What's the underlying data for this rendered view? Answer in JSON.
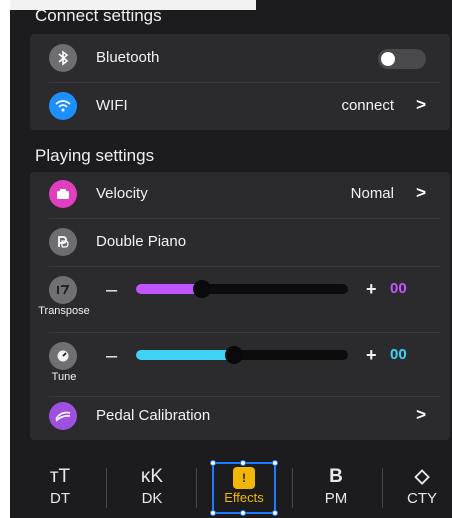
{
  "connect": {
    "title": "Connect settings",
    "bluetooth": {
      "label": "Bluetooth",
      "icon": "bluetooth-icon",
      "enabled": false
    },
    "wifi": {
      "label": "WIFI",
      "icon": "wifi-icon",
      "value": "connect",
      "chevron": ">"
    }
  },
  "playing": {
    "title": "Playing settings",
    "velocity": {
      "label": "Velocity",
      "icon": "velocity-icon",
      "value": "Nomal",
      "chevron": ">"
    },
    "double_piano": {
      "label": "Double Piano",
      "icon": "double-piano-icon"
    },
    "transpose": {
      "caption": "Transpose",
      "minus": "–",
      "plus": "+",
      "value_text": "00",
      "level": 0.31,
      "color": "#c056ff"
    },
    "tune": {
      "caption": "Tune",
      "minus": "–",
      "plus": "+",
      "value_text": "00",
      "level": 0.46,
      "color": "#3fd2f5"
    },
    "pedal": {
      "label": "Pedal Calibration",
      "icon": "pedal-icon",
      "chevron": ">"
    }
  },
  "tabs": [
    {
      "glyph": "ᴛT",
      "label": "DT",
      "active": false
    },
    {
      "glyph": "ᴋK",
      "label": "DK",
      "active": false
    },
    {
      "glyph": "!",
      "label": "Effects",
      "active": true
    },
    {
      "glyph": "B",
      "label": "PM",
      "active": false
    },
    {
      "glyph": "◇",
      "label": "CTY",
      "active": false
    }
  ],
  "colors": {
    "accent": "#f2b705",
    "selection": "#1e7bff",
    "wifi_icon": "#1e8fff",
    "velocity_icon": "#e040c0",
    "pedal_icon": "#a050e0",
    "bluetooth_icon": "#6e6e70",
    "double_piano_icon": "#6e6e70"
  }
}
